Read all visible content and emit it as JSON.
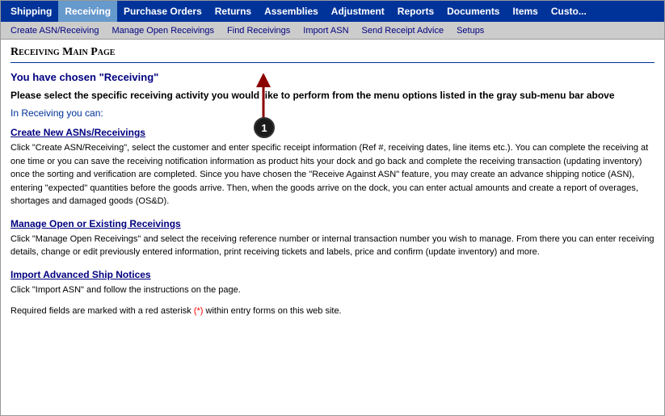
{
  "topNav": {
    "items": [
      {
        "label": "Shipping",
        "active": false
      },
      {
        "label": "Receiving",
        "active": true
      },
      {
        "label": "Purchase Orders",
        "active": false
      },
      {
        "label": "Returns",
        "active": false
      },
      {
        "label": "Assemblies",
        "active": false
      },
      {
        "label": "Adjustment",
        "active": false
      },
      {
        "label": "Reports",
        "active": false
      },
      {
        "label": "Documents",
        "active": false
      },
      {
        "label": "Items",
        "active": false
      },
      {
        "label": "Custo...",
        "active": false
      }
    ]
  },
  "subNav": {
    "items": [
      {
        "label": "Create ASN/Receiving"
      },
      {
        "label": "Manage Open Receivings"
      },
      {
        "label": "Find Receivings"
      },
      {
        "label": "Import ASN"
      },
      {
        "label": "Send Receipt Advice"
      },
      {
        "label": "Setups"
      }
    ]
  },
  "page": {
    "title": "Receiving Main Page",
    "mainHeading": "You have chosen \"Receiving\"",
    "subHeading": "Please select the specific receiving activity you would like to perform from the menu options listed in the gray sub-menu bar above",
    "inReceiving": "In Receiving you can:",
    "sections": [
      {
        "link": "Create New ASNs/Receivings",
        "desc": "Click \"Create ASN/Receiving\", select the customer and enter specific receipt information (Ref #, receiving dates, line items etc.). You can complete the receiving at one time or you can save the receiving notification information as product hits your dock and go back and complete the receiving transaction (updating inventory) once the sorting and verification are completed. Since you have chosen the \"Receive Against ASN\" feature, you may create an advance shipping notice (ASN), entering \"expected\" quantities before the goods arrive. Then, when the goods arrive on the dock, you can enter actual amounts and create a report of overages, shortages and damaged goods (OS&D)."
      },
      {
        "link": "Manage Open or Existing Receivings",
        "desc": "Click \"Manage Open Receivings\" and select the receiving reference number or internal transaction number you wish to manage. From there you can enter receiving details, change or edit previously entered information, print receiving tickets and labels, price and confirm (update inventory) and more."
      },
      {
        "link": "Import Advanced Ship Notices",
        "desc": "Click \"Import ASN\" and follow the instructions on the page."
      }
    ],
    "footerNote": "Required fields are marked with a red asterisk (*) within entry forms on this web site.",
    "annotation": {
      "number": "1"
    }
  }
}
